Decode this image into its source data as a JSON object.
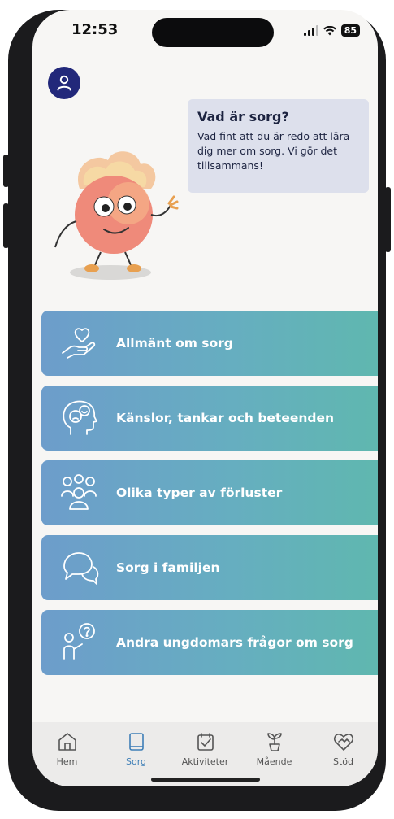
{
  "status_bar": {
    "time": "12:53",
    "battery": "85"
  },
  "header": {
    "avatar_icon": "user-icon"
  },
  "intro": {
    "title": "Vad är sorg?",
    "text": "Vad fint att du är redo att lära dig mer om sorg. Vi gör det tillsammans!"
  },
  "menu": [
    {
      "label": "Allmänt om sorg",
      "icon": "hand-heart-icon"
    },
    {
      "label": "Känslor, tankar och beteenden",
      "icon": "head-emotions-icon"
    },
    {
      "label": "Olika typer av förluster",
      "icon": "people-group-icon"
    },
    {
      "label": "Sorg i familjen",
      "icon": "speech-bubbles-icon"
    },
    {
      "label": "Andra ungdomars frågor om sorg",
      "icon": "person-question-icon"
    }
  ],
  "tabs": [
    {
      "label": "Hem",
      "icon": "home-icon",
      "active": false
    },
    {
      "label": "Sorg",
      "icon": "book-icon",
      "active": true
    },
    {
      "label": "Aktiviteter",
      "icon": "checklist-icon",
      "active": false
    },
    {
      "label": "Mående",
      "icon": "plant-icon",
      "active": false
    },
    {
      "label": "Stöd",
      "icon": "heart-handshake-icon",
      "active": false
    }
  ],
  "colors": {
    "accent": "#3f7fb7",
    "avatar_bg": "#22287a",
    "card_start": "#6d9dcb",
    "card_end": "#5fb8ae"
  }
}
